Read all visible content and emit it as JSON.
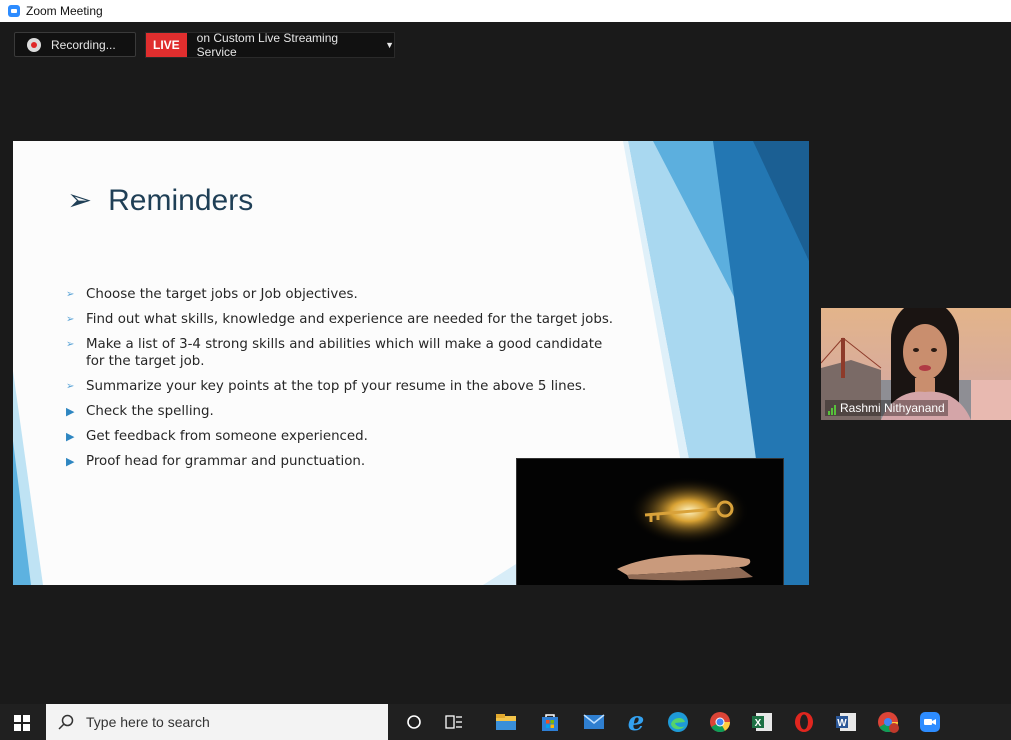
{
  "window": {
    "title": "Zoom Meeting"
  },
  "recording": {
    "label": "Recording..."
  },
  "live": {
    "badge": "LIVE",
    "service": "on Custom Live Streaming Service"
  },
  "slide": {
    "title": "Reminders",
    "bullets": [
      {
        "text": "Choose the target jobs or Job objectives.",
        "style": "outline"
      },
      {
        "text": "Find out what skills, knowledge and experience are needed for the target jobs.",
        "style": "outline"
      },
      {
        "text": "Make a list of 3-4 strong skills and abilities which will make a good candidate for the target job.",
        "style": "outline"
      },
      {
        "text": "Summarize your key points at the top pf your resume in the above 5 lines.",
        "style": "outline"
      },
      {
        "text": "Check the spelling.",
        "style": "solid"
      },
      {
        "text": "Get feedback from someone experienced.",
        "style": "solid"
      },
      {
        "text": "Proof head for grammar and punctuation.",
        "style": "solid"
      }
    ]
  },
  "participant": {
    "name": "Rashmi Nithyanand"
  },
  "taskbar": {
    "search_placeholder": "Type here to search",
    "icons": [
      "windows-start-icon",
      "cortana-icon",
      "task-view-icon",
      "file-explorer-icon",
      "store-icon",
      "mail-icon",
      "internet-explorer-icon",
      "edge-icon",
      "chrome-icon",
      "excel-icon",
      "opera-icon",
      "word-icon",
      "chrome-profile-icon",
      "zoom-icon"
    ]
  },
  "colors": {
    "live_red": "#e02e2e",
    "slide_title": "#1f3f56",
    "accent_blue": "#2e86c1",
    "zoom_blue": "#2d8cff"
  }
}
